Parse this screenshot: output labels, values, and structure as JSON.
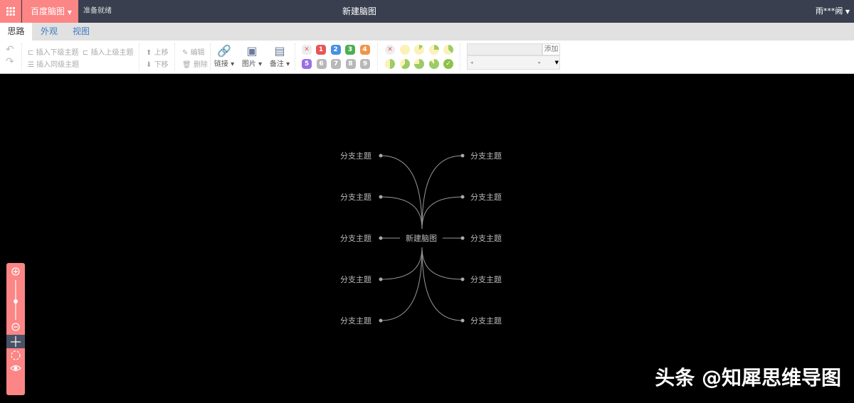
{
  "topbar": {
    "app_name": "百度脑图",
    "status": "准备就绪",
    "doc_title": "新建脑图",
    "user": "雨***阙"
  },
  "tabs": [
    {
      "label": "思路"
    },
    {
      "label": "外观"
    },
    {
      "label": "视图"
    }
  ],
  "toolbar": {
    "insert_child": "插入下级主题",
    "insert_parent": "插入上级主题",
    "insert_sibling": "插入同级主题",
    "move_up": "上移",
    "move_down": "下移",
    "edit": "编辑",
    "delete": "删除",
    "link": "链接",
    "image": "图片",
    "note": "备注",
    "add": "添加"
  },
  "priorities": [
    "1",
    "2",
    "3",
    "4",
    "5",
    "6",
    "7",
    "8",
    "9"
  ],
  "priority_colors": [
    "#e85555",
    "#4a90e2",
    "#4caf50",
    "#f0954a",
    "#9b6fe8",
    "#b8b8b8",
    "#b8b8b8",
    "#b8b8b8",
    "#b8b8b8"
  ],
  "mindmap": {
    "root": "新建脑图",
    "left": [
      "分支主题",
      "分支主题",
      "分支主题",
      "分支主题",
      "分支主题"
    ],
    "right": [
      "分支主题",
      "分支主题",
      "分支主题",
      "分支主题",
      "分支主题"
    ]
  },
  "watermark": "头条 @知犀思维导图"
}
